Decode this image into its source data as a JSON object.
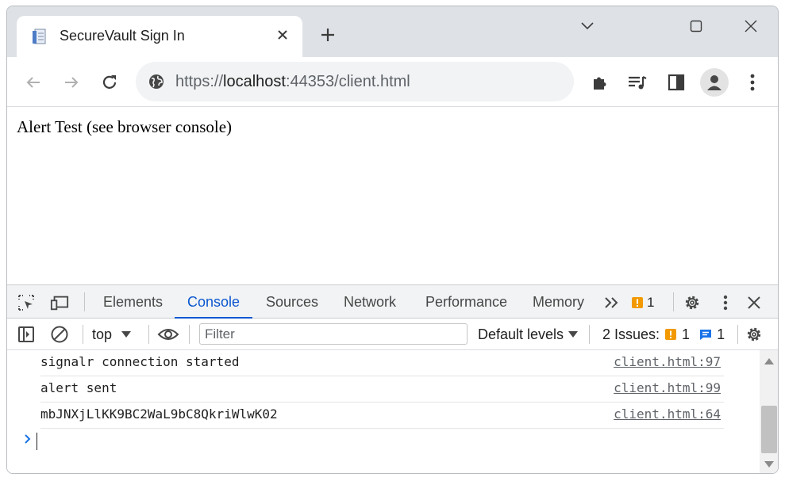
{
  "browser": {
    "tab": {
      "title": "SecureVault Sign In",
      "favicon": "page-icon"
    },
    "address": {
      "scheme": "https://",
      "host": "localhost",
      "rest": ":44353/client.html"
    }
  },
  "page": {
    "text": "Alert Test (see browser console)"
  },
  "devtools": {
    "tabs": [
      "Elements",
      "Console",
      "Sources",
      "Network",
      "Performance",
      "Memory"
    ],
    "active_tab": "Console",
    "warning_count": "1",
    "console_toolbar": {
      "context": "top",
      "filter_placeholder": "Filter",
      "levels": "Default levels",
      "issues_label": "2 Issues:",
      "issues_warn": "1",
      "issues_info": "1"
    },
    "logs": [
      {
        "message": "signalr connection started",
        "source": "client.html:97"
      },
      {
        "message": "alert sent",
        "source": "client.html:99"
      },
      {
        "message": "mbJNXjLlKK9BC2WaL9bC8QkriWlwK02",
        "source": "client.html:64"
      }
    ]
  },
  "colors": {
    "accent": "#0b57d0",
    "warning": "#f29900",
    "info": "#1a73e8",
    "tabstrip": "#dee1e6"
  }
}
